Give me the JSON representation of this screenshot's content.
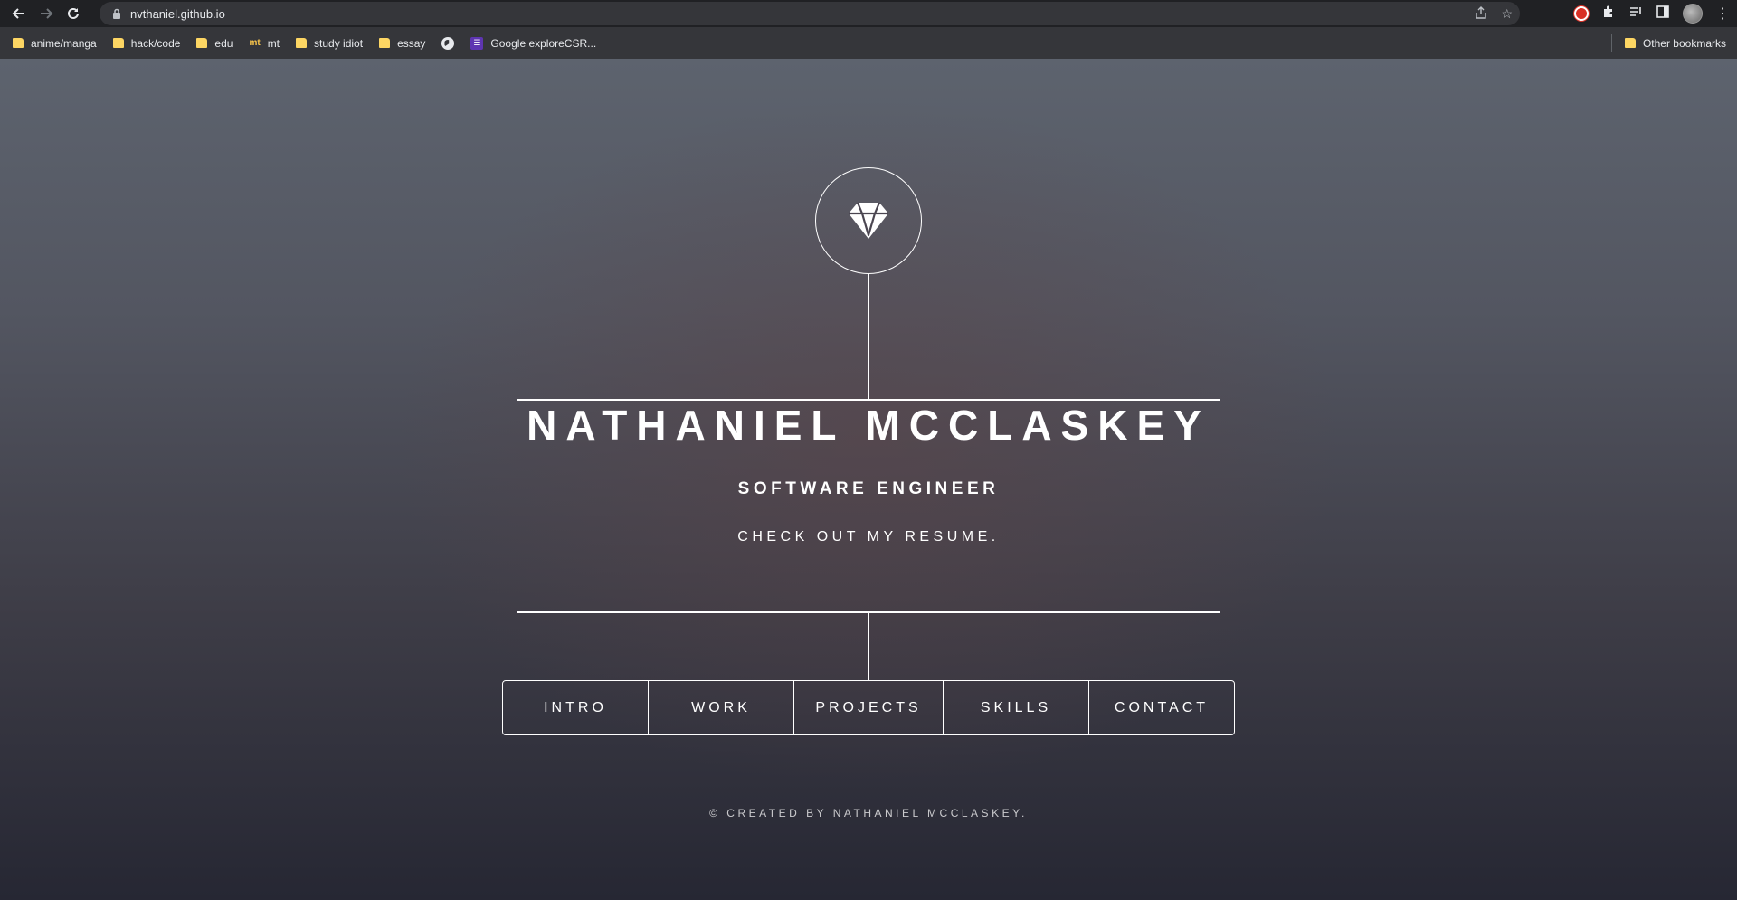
{
  "browser": {
    "url": "nvthaniel.github.io",
    "bookmarks": [
      {
        "label": "anime/manga",
        "icon": "folder-icon"
      },
      {
        "label": "hack/code",
        "icon": "folder-icon"
      },
      {
        "label": "edu",
        "icon": "folder-icon"
      },
      {
        "label": "mt",
        "icon": "mt-favicon"
      },
      {
        "label": "study idiot",
        "icon": "folder-icon"
      },
      {
        "label": "essay",
        "icon": "folder-icon"
      },
      {
        "label": "",
        "icon": "globe-icon"
      },
      {
        "label": "Google exploreCSR...",
        "icon": "google-classroom-icon"
      }
    ],
    "other_bookmarks": "Other bookmarks",
    "mt_icon_text": "mt"
  },
  "site": {
    "name": "NATHANIEL MCCLASKEY",
    "role": "SOFTWARE ENGINEER",
    "tagline_prefix": "CHECK OUT MY ",
    "resume_link": "RESUME",
    "tagline_suffix": ".",
    "nav": [
      "INTRO",
      "WORK",
      "PROJECTS",
      "SKILLS",
      "CONTACT"
    ],
    "footer": "© CREATED BY NATHANIEL MCCLASKEY."
  },
  "colors": {
    "chrome_bg": "#202124",
    "bookmarks_bg": "#35363a",
    "text": "#ffffff"
  }
}
